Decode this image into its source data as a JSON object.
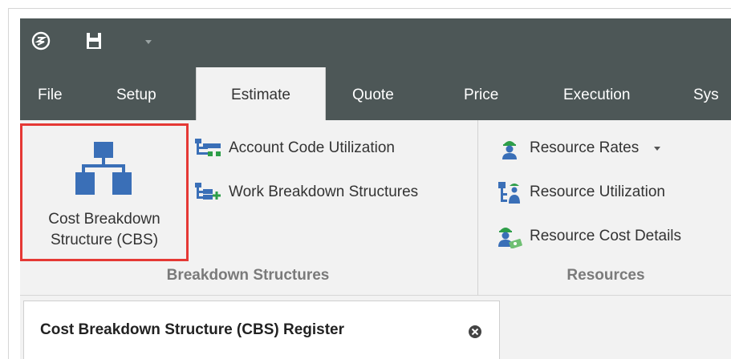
{
  "quick_access": {
    "icons": [
      "app-logo-icon",
      "save-icon",
      "chevron-down-icon"
    ]
  },
  "tabs": [
    {
      "label": "File"
    },
    {
      "label": "Setup"
    },
    {
      "label": "Estimate",
      "active": true
    },
    {
      "label": "Quote"
    },
    {
      "label": "Price"
    },
    {
      "label": "Execution"
    },
    {
      "label": "Sys"
    }
  ],
  "ribbon": {
    "breakdown_group": {
      "label": "Breakdown Structures",
      "cbs_button": {
        "line1": "Cost Breakdown",
        "line2": "Structure (CBS)",
        "icon": "hierarchy-icon",
        "highlighted": true
      },
      "account_code_button": {
        "label": "Account Code Utilization",
        "icon": "account-code-icon"
      },
      "wbs_button": {
        "label": "Work Breakdown Structures",
        "icon": "wbs-icon"
      }
    },
    "resources_group": {
      "label": "Resources",
      "resource_rates_button": {
        "label": "Resource Rates",
        "icon": "worker-icon",
        "has_dropdown": true
      },
      "resource_utilization_button": {
        "label": "Resource Utilization",
        "icon": "resource-utilization-icon"
      },
      "resource_cost_details_button": {
        "label": "Resource Cost Details",
        "icon": "worker-money-icon"
      }
    }
  },
  "document_tab": {
    "label": "Cost Breakdown Structure (CBS) Register",
    "close_icon": "close-circle-icon"
  },
  "colors": {
    "titlebar": "#4d5757",
    "ribbon_bg": "#f2f2f2",
    "highlight_border": "#e53935",
    "icon_blue": "#3a6fb7",
    "icon_green": "#2e9e49"
  }
}
